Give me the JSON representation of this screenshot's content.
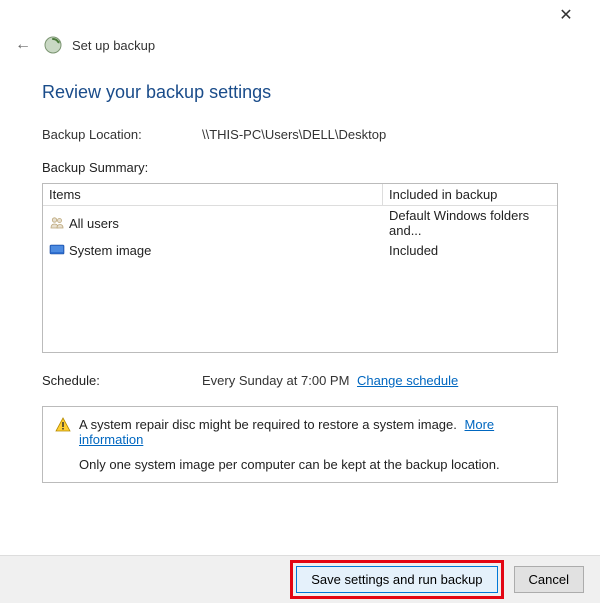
{
  "titlebar": {
    "close_label": "✕"
  },
  "header": {
    "back_glyph": "←",
    "wizard_title": "Set up backup"
  },
  "heading": "Review your backup settings",
  "location": {
    "label": "Backup Location:",
    "value": "\\\\THIS-PC\\Users\\DELL\\Desktop"
  },
  "summary": {
    "label": "Backup Summary:",
    "columns": {
      "items": "Items",
      "included": "Included in backup"
    },
    "rows": [
      {
        "icon": "users-icon",
        "item": "All users",
        "included": "Default Windows folders and..."
      },
      {
        "icon": "disk-image-icon",
        "item": "System image",
        "included": "Included"
      }
    ]
  },
  "schedule": {
    "label": "Schedule:",
    "value": "Every Sunday at 7:00 PM",
    "link": "Change schedule"
  },
  "notice": {
    "line1_text": "A system repair disc might be required to restore a system image.",
    "link": "More information",
    "line2": "Only one system image per computer can be kept at the backup location."
  },
  "footer": {
    "primary": "Save settings and run backup",
    "cancel": "Cancel"
  }
}
